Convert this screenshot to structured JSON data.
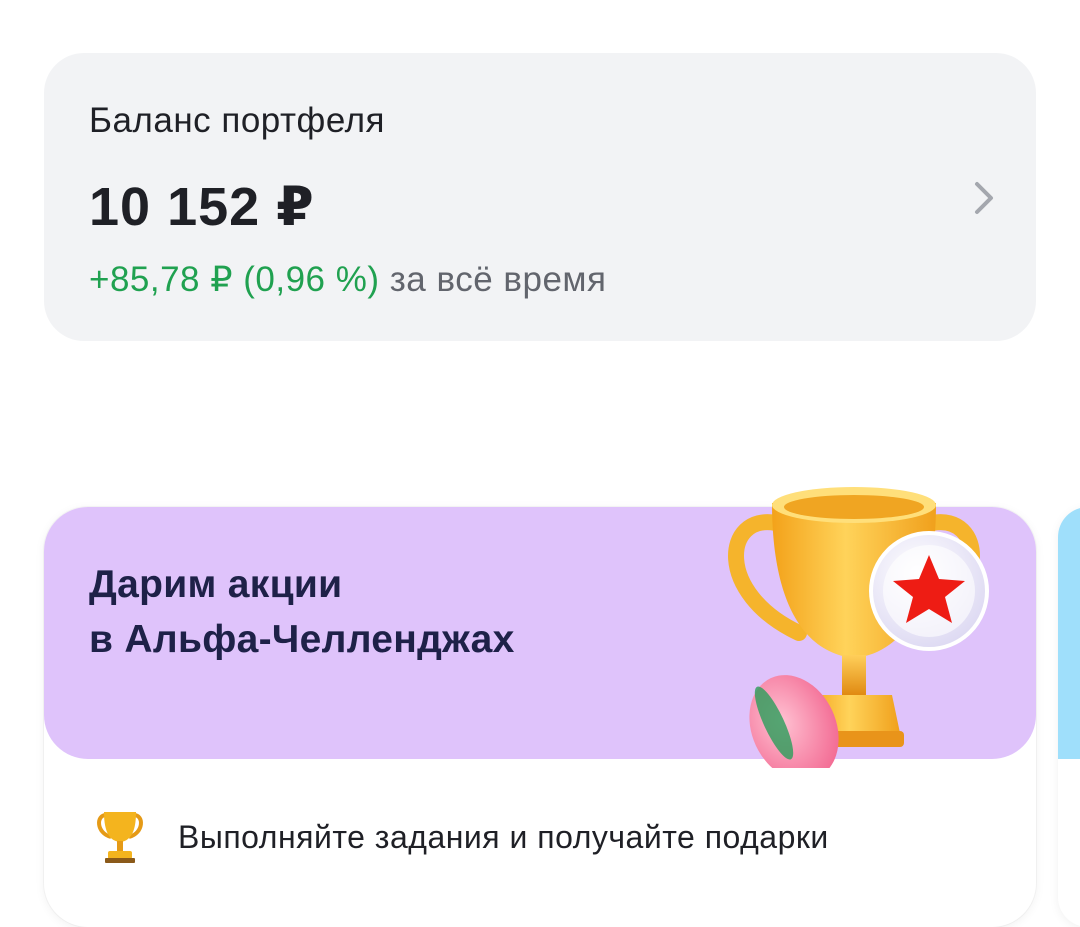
{
  "balance": {
    "label": "Баланс портфеля",
    "amount": "10 152 ₽",
    "change_value": "+85,78 ₽ (0,96 %)",
    "change_suffix": " за всё время",
    "change_color": "#20a150"
  },
  "promo": {
    "title_line1": "Дарим акции",
    "title_line2": "в Альфа-Челленджах",
    "footer_text": "Выполняйте задания и получайте подарки",
    "banner_color": "#dfc3fb",
    "icons": [
      "trophy-icon",
      "star-badge-icon"
    ]
  },
  "next_card": {
    "banner_color": "#9fdffb"
  }
}
